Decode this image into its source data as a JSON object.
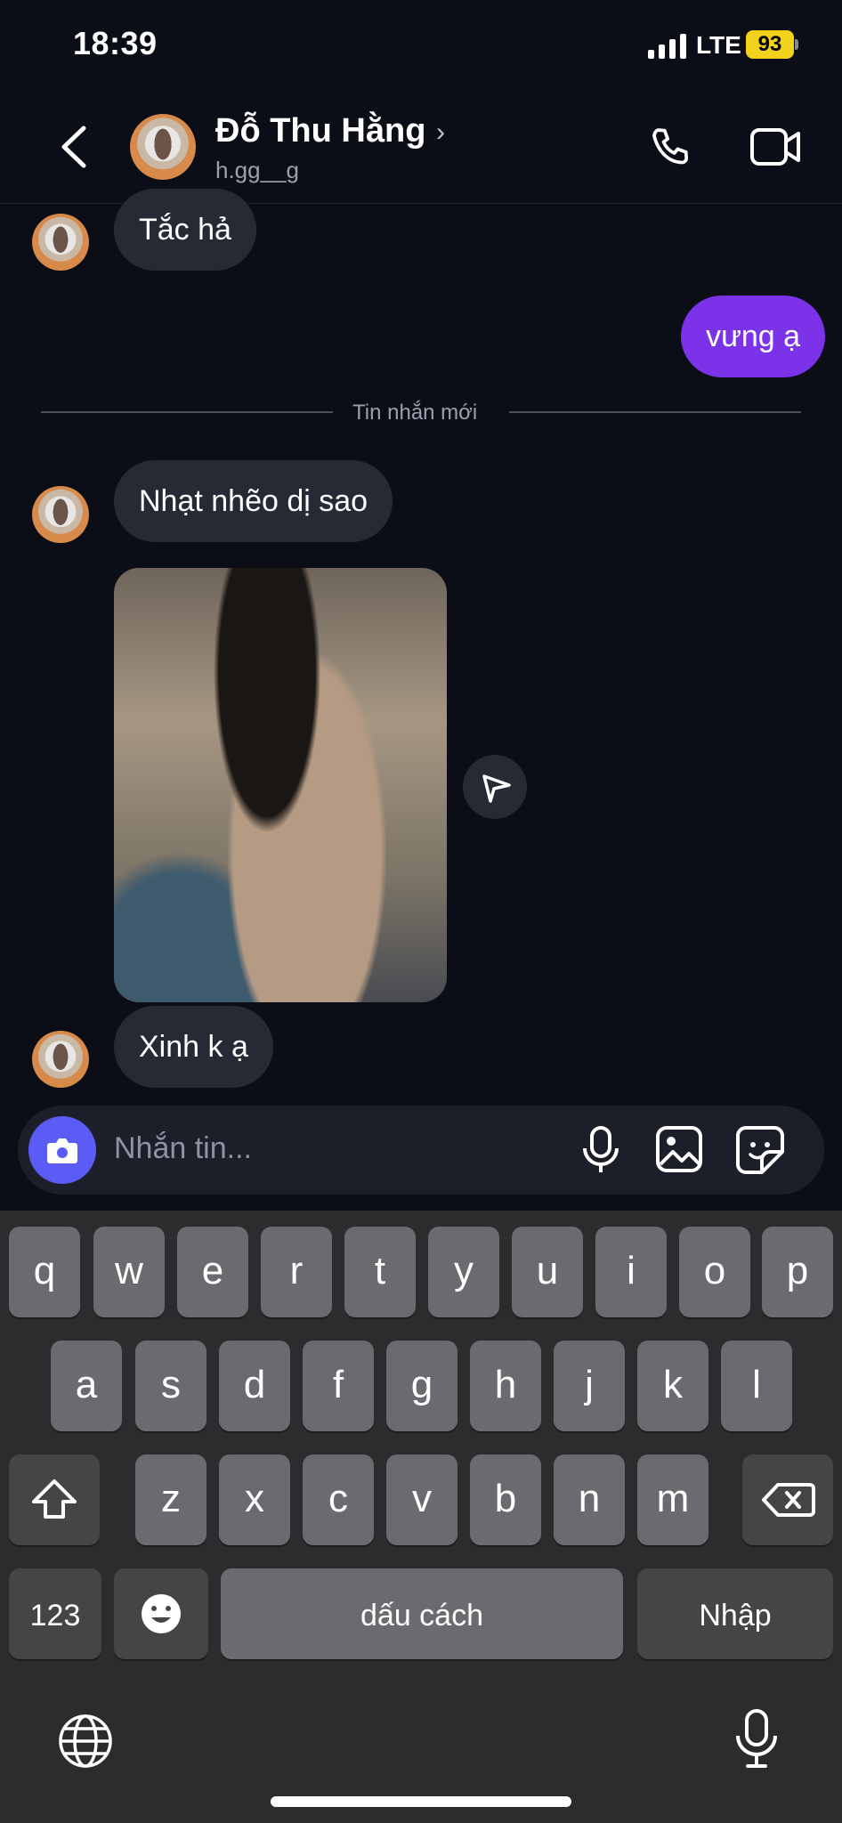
{
  "status_bar": {
    "time": "18:39",
    "network": "LTE",
    "battery": "93"
  },
  "header": {
    "contact_name": "Đỗ Thu Hằng",
    "username": "h.gg__g"
  },
  "messages": {
    "m1": "Tắc hả",
    "m2_me": "vưng ạ",
    "divider": "Tin nhắn mới",
    "m3": "Nhạt nhẽo dị sao",
    "m4": "Xinh k ạ"
  },
  "composer": {
    "placeholder": "Nhắn tin..."
  },
  "keyboard": {
    "row1": [
      "q",
      "w",
      "e",
      "r",
      "t",
      "y",
      "u",
      "i",
      "o",
      "p"
    ],
    "row2": [
      "a",
      "s",
      "d",
      "f",
      "g",
      "h",
      "j",
      "k",
      "l"
    ],
    "row3": [
      "z",
      "x",
      "c",
      "v",
      "b",
      "n",
      "m"
    ],
    "numbers_key": "123",
    "space_key": "dấu cách",
    "return_key": "Nhập"
  },
  "icons": [
    "back-chevron-icon",
    "phone-icon",
    "video-camera-icon",
    "share-icon",
    "camera-icon",
    "microphone-icon",
    "gallery-icon",
    "sticker-icon",
    "shift-icon",
    "delete-icon",
    "emoji-icon",
    "globe-icon",
    "dictation-icon"
  ],
  "colors": {
    "background": "#0b0e17",
    "incoming_bubble": "#262a35",
    "outgoing_bubble": "#7b32e8",
    "camera_button": "#5b5cf6",
    "battery": "#f2d21b"
  }
}
